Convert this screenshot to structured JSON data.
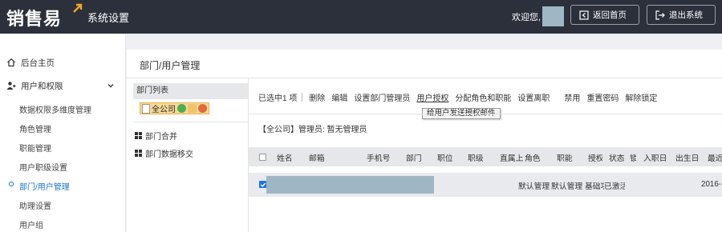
{
  "header": {
    "logo_text": "销售易",
    "app_title": "系统设置",
    "welcome": "欢迎您,",
    "home_button": "返回首页",
    "logout_button": "退出系统"
  },
  "sidebar": {
    "home": "后台主页",
    "users_group": "用户和权限",
    "sub_items": [
      "数据权限多维度管理",
      "角色管理",
      "职能管理",
      "用户职级设置",
      "部门/用户管理",
      "助理设置",
      "用户组"
    ],
    "active_index": 4
  },
  "main": {
    "page_title": "部门/用户管理",
    "tree_header": "部门列表",
    "tree_root": "全公司",
    "tree_actions": [
      "部门合并",
      "部门数据移交"
    ],
    "toolbar": {
      "selected": "已选中1 项",
      "items": [
        "删除",
        "编辑",
        "设置部门管理员",
        "用户授权",
        "分配角色和职能",
        "设置离职",
        "禁用",
        "重置密码",
        "解除锁定"
      ]
    },
    "tooltip": "给用户发送授权邮件",
    "admin_line": "【全公司】管理员:  暂无管理员",
    "table": {
      "headers": [
        "姓名",
        "邮箱",
        "手机号",
        "部门",
        "职位",
        "职级",
        "直属上",
        "角色",
        "职能",
        "授权",
        "状态",
        "锁",
        "入职日",
        "出生日",
        "最近"
      ],
      "row": {
        "checked": true,
        "role": "默认管理",
        "function": "默认管理",
        "auth": "基础功",
        "status": "已激活",
        "last": "2016-"
      }
    }
  },
  "colors": {
    "topbar": "#2b303b",
    "accent": "#1a73c9",
    "redaction": "#9fb7c4"
  }
}
